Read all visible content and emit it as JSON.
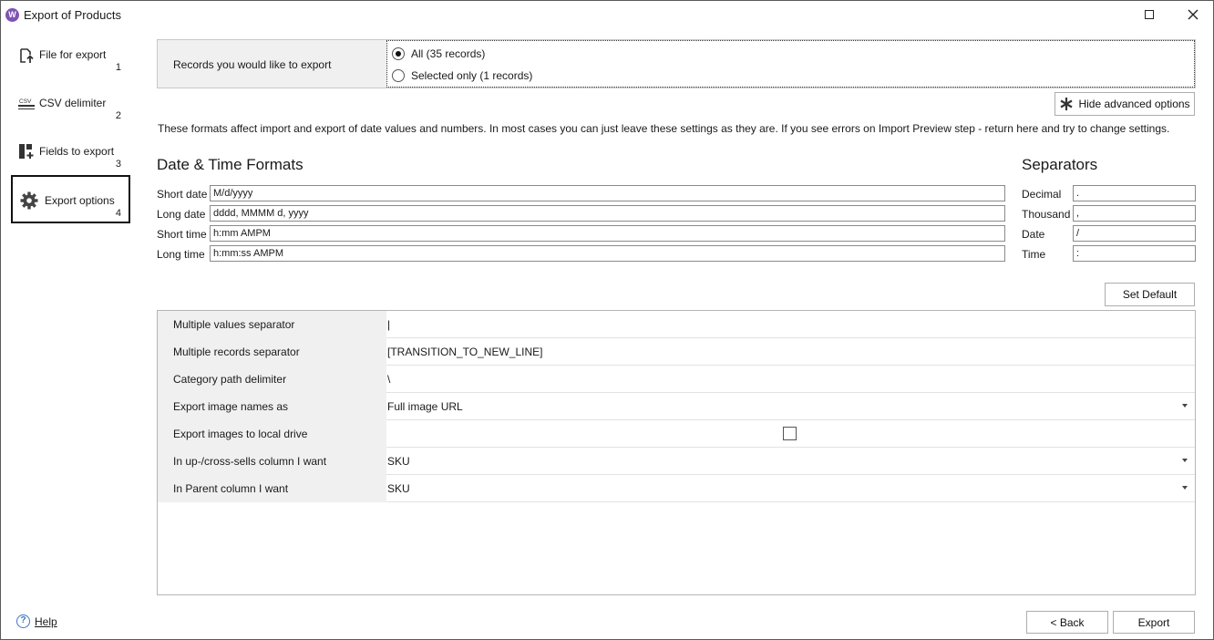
{
  "window": {
    "title": "Export of Products",
    "app_icon": "W"
  },
  "sidebar": {
    "items": [
      {
        "label": "File for export",
        "number": "1",
        "icon": "file-upload-icon"
      },
      {
        "label": "CSV delimiter",
        "number": "2",
        "icon": "csv-icon"
      },
      {
        "label": "Fields to export",
        "number": "3",
        "icon": "add-fields-icon"
      },
      {
        "label": "Export options",
        "number": "4",
        "icon": "gear-icon",
        "active": true
      }
    ],
    "help": "Help"
  },
  "records": {
    "label": "Records you would like to export",
    "options": [
      {
        "label": "All (35 records)",
        "checked": true
      },
      {
        "label": "Selected only (1 records)",
        "checked": false
      }
    ]
  },
  "advanced_button": "Hide advanced options",
  "info_text": "These formats affect import and export of date values and numbers. In most cases you can just leave these settings as they are. If you see errors on Import Preview step - return here and try to change settings.",
  "date_time": {
    "title": "Date & Time Formats",
    "fields": [
      {
        "label": "Short date",
        "value": "M/d/yyyy"
      },
      {
        "label": "Long date",
        "value": "dddd, MMMM d, yyyy"
      },
      {
        "label": "Short time",
        "value": "h:mm AMPM"
      },
      {
        "label": "Long time",
        "value": "h:mm:ss AMPM"
      }
    ]
  },
  "separators": {
    "title": "Separators",
    "fields": [
      {
        "label": "Decimal",
        "value": "."
      },
      {
        "label": "Thousand",
        "value": ","
      },
      {
        "label": "Date",
        "value": "/"
      },
      {
        "label": "Time",
        "value": ":"
      }
    ]
  },
  "set_default": "Set Default",
  "options_grid": [
    {
      "key": "Multiple values separator",
      "value": "|",
      "type": "text"
    },
    {
      "key": "Multiple records separator",
      "value": "[TRANSITION_TO_NEW_LINE]",
      "type": "text"
    },
    {
      "key": "Category path delimiter",
      "value": "\\",
      "type": "text"
    },
    {
      "key": "Export image names as",
      "value": "Full image URL",
      "type": "dropdown"
    },
    {
      "key": "Export images to local drive",
      "value": "",
      "type": "checkbox",
      "checked": false
    },
    {
      "key": "In up-/cross-sells column I want",
      "value": "SKU",
      "type": "dropdown"
    },
    {
      "key": "In Parent column I want",
      "value": "SKU",
      "type": "dropdown"
    }
  ],
  "footer": {
    "back": "< Back",
    "export": "Export"
  }
}
